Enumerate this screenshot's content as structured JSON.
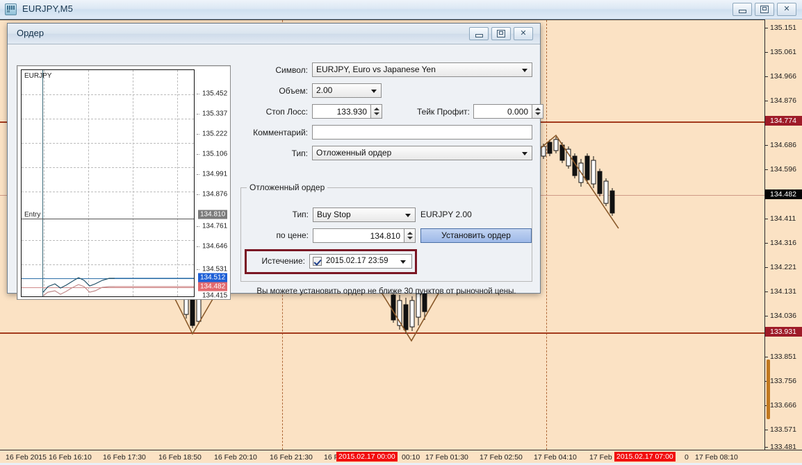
{
  "app": {
    "title": "EURJPY,M5",
    "icon": "chart-window-icon",
    "minimize": "–",
    "maximize": "□",
    "close": "✕"
  },
  "dialog": {
    "title": "Ордер",
    "minimize": "–",
    "maximize": "□",
    "close": "✕",
    "minichart": {
      "symbol": "EURJPY",
      "entry_label": "Entry",
      "scale_labels": [
        "135.452",
        "135.337",
        "135.222",
        "135.106",
        "134.991",
        "134.876",
        "134.761",
        "134.646",
        "134.531",
        "134.415"
      ],
      "badges": [
        {
          "value": "134.810",
          "kind": "gray"
        },
        {
          "value": "134.512",
          "kind": "blue"
        },
        {
          "value": "134.482",
          "kind": "red"
        }
      ]
    },
    "form": {
      "symbol_label": "Символ:",
      "symbol_value": "EURJPY, Euro vs Japanese Yen",
      "volume_label": "Объем:",
      "volume_value": "2.00",
      "stoploss_label": "Стоп Лосс:",
      "stoploss_value": "133.930",
      "takeprofit_label": "Тейк Профит:",
      "takeprofit_value": "0.000",
      "comment_label": "Комментарий:",
      "comment_value": "",
      "type_label": "Тип:",
      "type_value": "Отложенный ордер"
    },
    "pending": {
      "legend": "Отложенный ордер",
      "type_label": "Тип:",
      "type_value": "Buy Stop",
      "ticket": "EURJPY 2.00",
      "price_label": "по цене:",
      "price_value": "134.810",
      "place_button": "Установить ордер",
      "expiry_label": "Истечение:",
      "expiry_value": "2015.02.17 23:59",
      "expiry_checked": true
    },
    "hint": "Вы можете установить ордер не ближе 30 пунктов от рыночной цены."
  },
  "chart_data": {
    "type": "candlestick",
    "title": "EURJPY,M5",
    "symbol": "EURJPY",
    "timeframe": "M5",
    "background": "#fbe2c4",
    "price_axis": {
      "labels": [
        "135.151",
        "135.061",
        "134.966",
        "134.876",
        "134.686",
        "134.596",
        "134.411",
        "134.316",
        "134.221",
        "134.131",
        "134.036",
        "133.851",
        "133.756",
        "133.666",
        "133.571",
        "133.481"
      ],
      "highlighted": [
        {
          "value": "134.774",
          "kind": "red",
          "role": "resistance-level"
        },
        {
          "value": "134.482",
          "kind": "black",
          "role": "current-bid"
        },
        {
          "value": "133.931",
          "kind": "red",
          "role": "support-level"
        }
      ],
      "min": 133.481,
      "max": 135.151
    },
    "time_axis": {
      "labels": [
        "16 Feb 2015",
        "16 Feb 16:10",
        "16 Feb 17:30",
        "16 Feb 18:50",
        "16 Feb 20:10",
        "16 Feb 21:30",
        "16 F",
        "00:10",
        "17 Feb 01:30",
        "17 Feb 02:50",
        "17 Feb 04:10",
        "17 Feb",
        "0",
        "17 Feb 08:10"
      ],
      "highlighted": [
        "2015.02.17 00:00",
        "2015.02.17 07:00"
      ]
    },
    "levels": [
      {
        "price": "134.774",
        "color": "#a33a1c",
        "style": "solid"
      },
      {
        "price": "133.931",
        "color": "#a33a1c",
        "style": "solid"
      },
      {
        "price": "134.482",
        "color": "#cf9a86",
        "style": "thin"
      }
    ]
  }
}
